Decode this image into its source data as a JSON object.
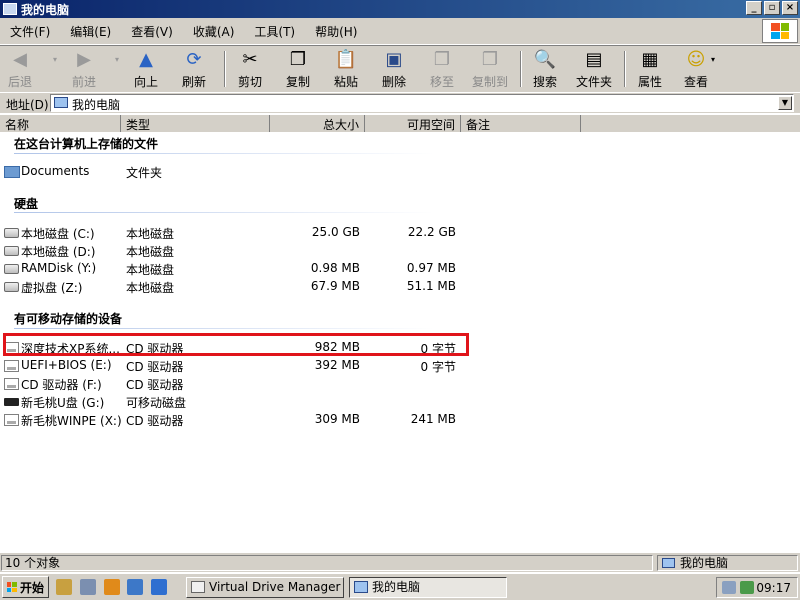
{
  "window": {
    "title": "我的电脑"
  },
  "menu": [
    "文件(F)",
    "编辑(E)",
    "查看(V)",
    "收藏(A)",
    "工具(T)",
    "帮助(H)"
  ],
  "toolbar": {
    "back": "后退",
    "forward": "前进",
    "up": "向上",
    "refresh": "刷新",
    "cut": "剪切",
    "copy": "复制",
    "paste": "粘贴",
    "delete": "删除",
    "move_to": "移至",
    "copy_to": "复制到",
    "search": "搜索",
    "folders": "文件夹",
    "properties": "属性",
    "view": "查看"
  },
  "address": {
    "label": "地址(D)",
    "value": "我的电脑"
  },
  "columns": {
    "name": "名称",
    "type": "类型",
    "total": "总大小",
    "free": "可用空间",
    "comment": "备注"
  },
  "groups": {
    "stored": "在这台计算机上存储的文件",
    "hard_disks": "硬盘",
    "removable": "有可移动存储的设备"
  },
  "stored_items": [
    {
      "name": "Documents",
      "type": "文件夹",
      "icon": "folder-icon"
    }
  ],
  "hard_disks": [
    {
      "name": "本地磁盘 (C:)",
      "type": "本地磁盘",
      "total": "25.0 GB",
      "free": "22.2 GB",
      "icon": "hard-drive-icon"
    },
    {
      "name": "本地磁盘 (D:)",
      "type": "本地磁盘",
      "total": "",
      "free": "",
      "icon": "hard-drive-icon"
    },
    {
      "name": "RAMDisk (Y:)",
      "type": "本地磁盘",
      "total": "0.98 MB",
      "free": "0.97 MB",
      "icon": "hard-drive-icon"
    },
    {
      "name": "虚拟盘 (Z:)",
      "type": "本地磁盘",
      "total": "67.9 MB",
      "free": "51.1 MB",
      "icon": "hard-drive-icon"
    }
  ],
  "removable": [
    {
      "name": "深度技术XP系统...",
      "type": "CD 驱动器",
      "total": "982 MB",
      "free": "0 字节",
      "icon": "cd-drive-icon"
    },
    {
      "name": "UEFI+BIOS (E:)",
      "type": "CD 驱动器",
      "total": "392 MB",
      "free": "0 字节",
      "icon": "cd-drive-icon"
    },
    {
      "name": "CD 驱动器 (F:)",
      "type": "CD 驱动器",
      "total": "",
      "free": "",
      "icon": "cd-drive-icon"
    },
    {
      "name": "新毛桃U盘 (G:)",
      "type": "可移动磁盘",
      "total": "",
      "free": "",
      "icon": "usb-drive-icon"
    },
    {
      "name": "新毛桃WINPE (X:)",
      "type": "CD 驱动器",
      "total": "309 MB",
      "free": "241 MB",
      "icon": "cd-drive-icon"
    }
  ],
  "status": {
    "count": "10 个对象",
    "location": "我的电脑"
  },
  "taskbar": {
    "start": "开始",
    "tasks": [
      "Virtual Drive Manager",
      "我的电脑"
    ],
    "clock": "09:17"
  },
  "colors": {
    "title_bar": "#0a246a",
    "chrome": "#d4d0c8",
    "highlight_box": "#e0141a"
  }
}
